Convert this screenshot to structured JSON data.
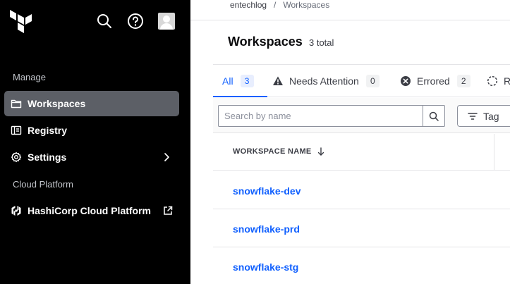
{
  "colors": {
    "sidebar_bg": "#000000",
    "active_nav_bg": "#5c5f66",
    "accent": "#1060ff",
    "border": "#e4e4e7"
  },
  "topbar_icons": [
    "search-icon",
    "help-icon",
    "user-avatar"
  ],
  "sidebar": {
    "manage_label": "Manage",
    "items": [
      {
        "label": "Workspaces",
        "icon": "folder-icon",
        "active": true
      },
      {
        "label": "Registry",
        "icon": "registry-icon",
        "active": false
      },
      {
        "label": "Settings",
        "icon": "gear-icon",
        "active": false,
        "trailing_icon": "chevron-right-icon"
      }
    ],
    "cloud_label": "Cloud Platform",
    "cloud_items": [
      {
        "label": "HashiCorp Cloud Platform",
        "icon": "hashicorp-icon",
        "trailing_icon": "external-link-icon"
      }
    ]
  },
  "breadcrumb": {
    "org": "entechlog",
    "separator": "/",
    "current": "Workspaces"
  },
  "page": {
    "title": "Workspaces",
    "total": "3 total"
  },
  "tabs": [
    {
      "label": "All",
      "count": "3",
      "active": true,
      "icon": ""
    },
    {
      "label": "Needs Attention",
      "count": "0",
      "active": false,
      "icon": "warning-icon"
    },
    {
      "label": "Errored",
      "count": "2",
      "active": false,
      "icon": "x-circle-icon"
    },
    {
      "label": "R",
      "count": "",
      "active": false,
      "icon": "loading-icon"
    }
  ],
  "filter": {
    "search_placeholder": "Search by name",
    "search_value": "",
    "tag_label": "Tag"
  },
  "table": {
    "column_header": "WORKSPACE NAME",
    "sort_icon": "arrow-down-icon",
    "rows": [
      {
        "name": "snowflake-dev"
      },
      {
        "name": "snowflake-prd"
      },
      {
        "name": "snowflake-stg"
      }
    ]
  }
}
